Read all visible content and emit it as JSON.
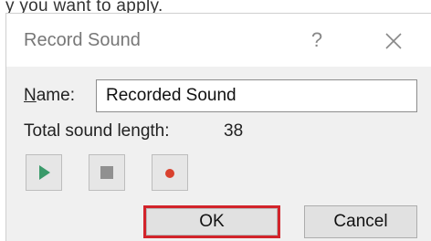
{
  "caption": {
    "text": "y you want to apply."
  },
  "dialog": {
    "title": "Record Sound",
    "help_label": "?",
    "name_field": {
      "label_mnemonic": "N",
      "label_rest": "ame:",
      "value": "Recorded Sound"
    },
    "sound_length": {
      "label": "Total sound length:",
      "value": "38"
    },
    "controls": {
      "play_icon": "play-icon",
      "stop_icon": "stop-icon",
      "record_icon": "record-icon"
    },
    "buttons": {
      "ok_label": "OK",
      "cancel_label": "Cancel"
    }
  },
  "colors": {
    "play": "#3a9a6a",
    "stop": "#909090",
    "record": "#d9412e",
    "ok_highlight": "#d2232a"
  }
}
